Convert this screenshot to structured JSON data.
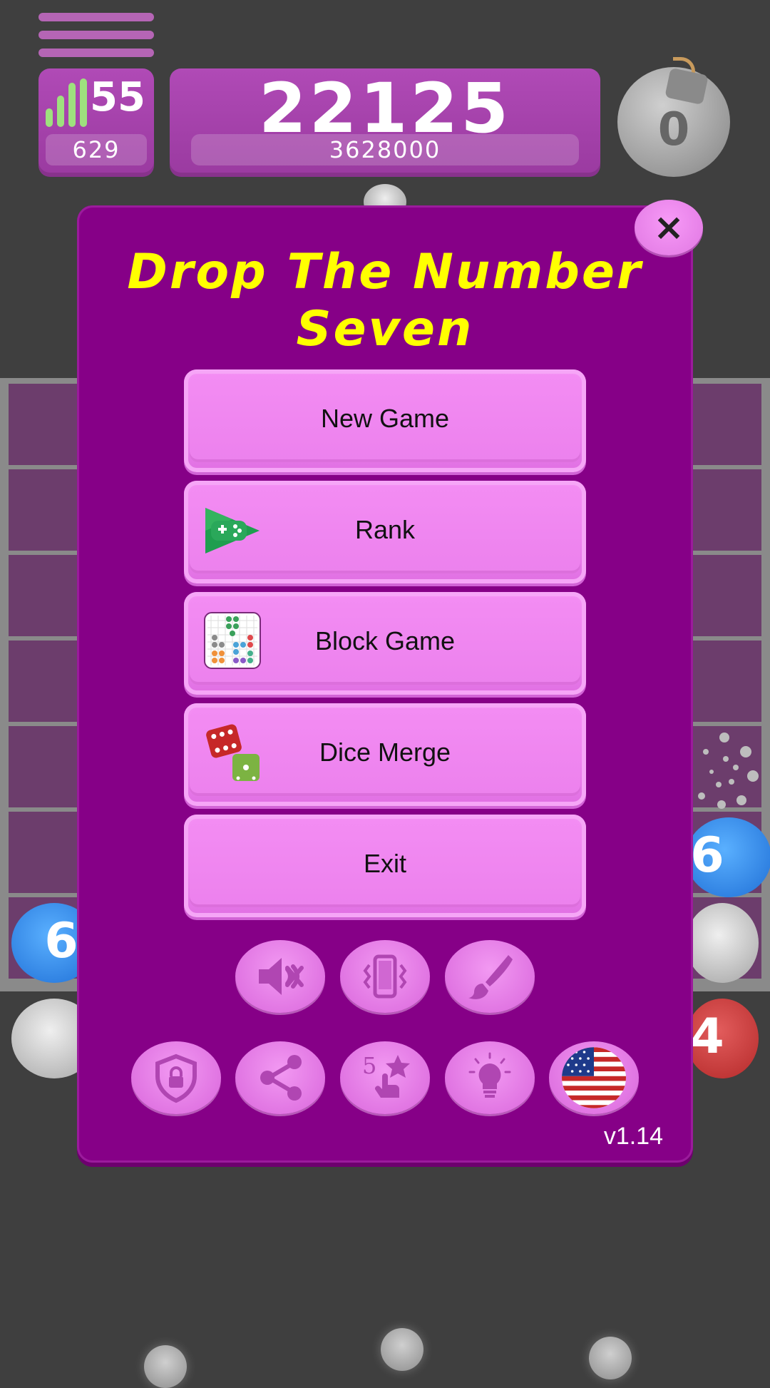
{
  "hud": {
    "level": "55",
    "level_sub": "629",
    "score": "22125",
    "best_score": "3628000",
    "bomb_count": "0"
  },
  "board": {
    "visible_ball_labels": [
      "6",
      "6",
      "4"
    ]
  },
  "dialog": {
    "title": "Drop The Number Seven",
    "close_label": "×",
    "buttons": [
      {
        "label": "New Game",
        "icon": ""
      },
      {
        "label": "Rank",
        "icon": "play-games-icon"
      },
      {
        "label": "Block Game",
        "icon": "block-game-app-icon"
      },
      {
        "label": "Dice Merge",
        "icon": "dice-merge-app-icon"
      },
      {
        "label": "Exit",
        "icon": ""
      }
    ],
    "toggles": [
      "sound-muted-icon",
      "vibration-icon",
      "theme-brush-icon"
    ],
    "extras": [
      "privacy-shield-icon",
      "share-icon",
      "rate-5-star-icon",
      "hint-bulb-icon",
      "language-flag-icon"
    ],
    "version": "v1.14"
  },
  "colors": {
    "dialog_bg": "#860087",
    "button_bg": "#ee82ee",
    "title": "#ffff00",
    "background": "#3f3f3f"
  }
}
